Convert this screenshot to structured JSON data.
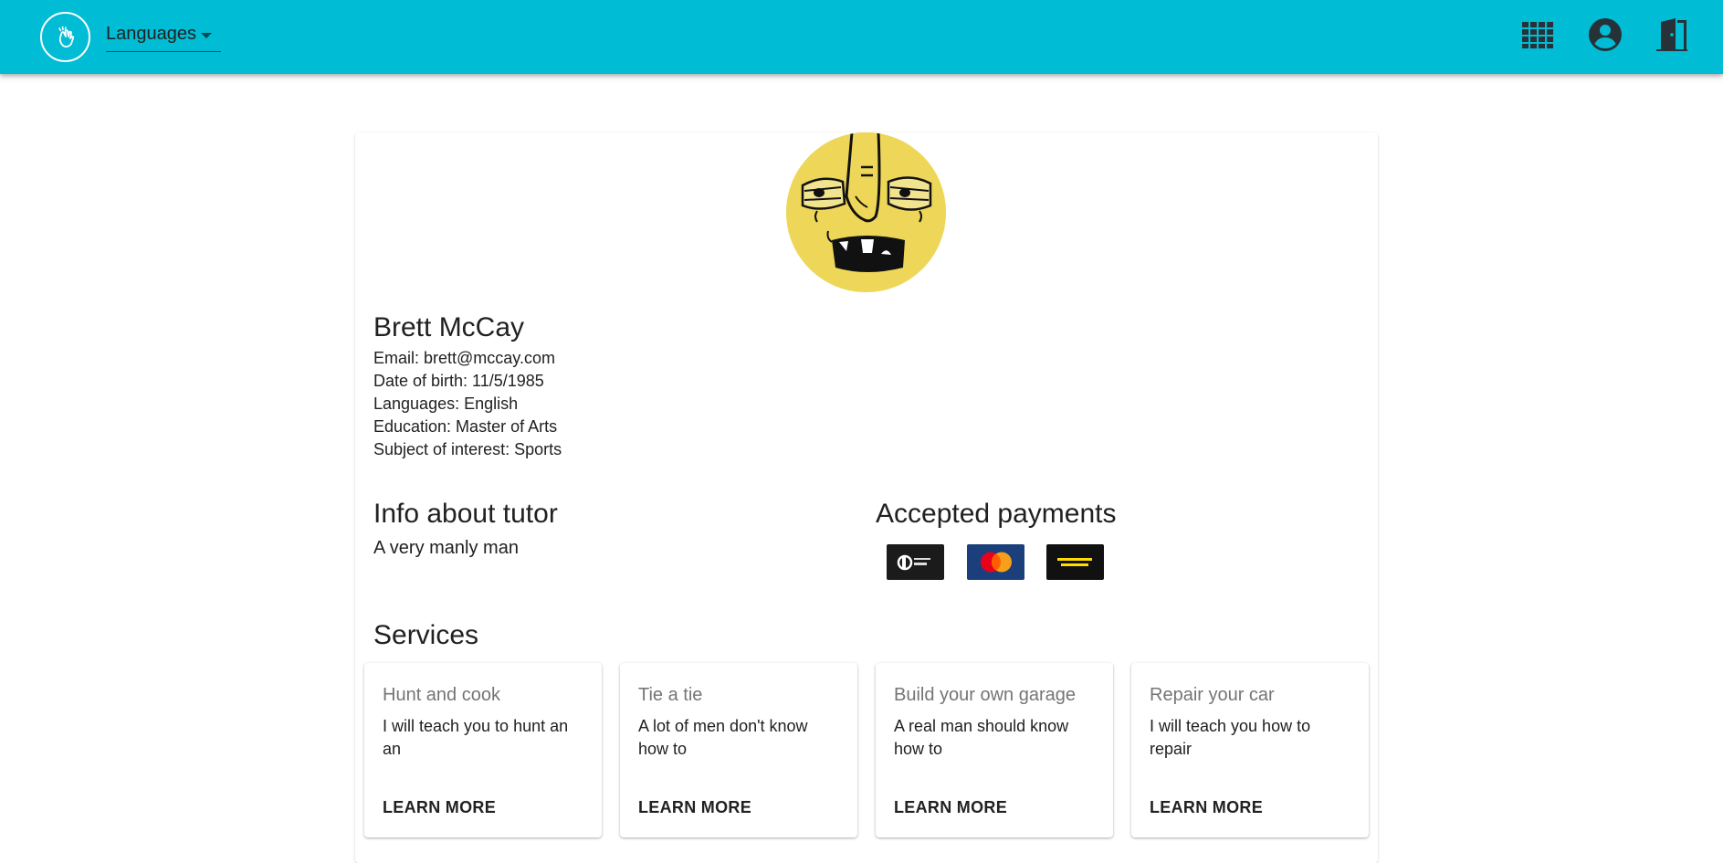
{
  "header": {
    "language_select_label": "Languages",
    "background_color": "#00BCD4",
    "logo_icon": "hand-wave-icon",
    "icons": [
      "apps-grid-icon",
      "account-circle-icon",
      "logout-door-icon"
    ]
  },
  "profile": {
    "avatar_icon": "cartoon-face-avatar",
    "name": "Brett McCay",
    "details": [
      "Email: brett@mccay.com",
      "Date of birth: 11/5/1985",
      "Languages: English",
      "Education: Master of Arts",
      "Subject of interest: Sports"
    ]
  },
  "info": {
    "title": "Info about tutor",
    "text": "A very manly man"
  },
  "payments": {
    "title": "Accepted payments",
    "methods": [
      {
        "icon": "direct-debit-logo"
      },
      {
        "icon": "mastercard-logo"
      },
      {
        "icon": "western-union-logo"
      }
    ]
  },
  "services": {
    "title": "Services",
    "items": [
      {
        "title": "Hunt and cook",
        "description": "I will teach you to hunt an an",
        "button": "LEARN MORE"
      },
      {
        "title": "Tie a tie",
        "description": "A lot of men don't know how to",
        "button": "LEARN MORE"
      },
      {
        "title": "Build your own garage",
        "description": "A real man should know how to",
        "button": "LEARN MORE"
      },
      {
        "title": "Repair your car",
        "description": "I will teach you how to repair",
        "button": "LEARN MORE"
      }
    ]
  }
}
